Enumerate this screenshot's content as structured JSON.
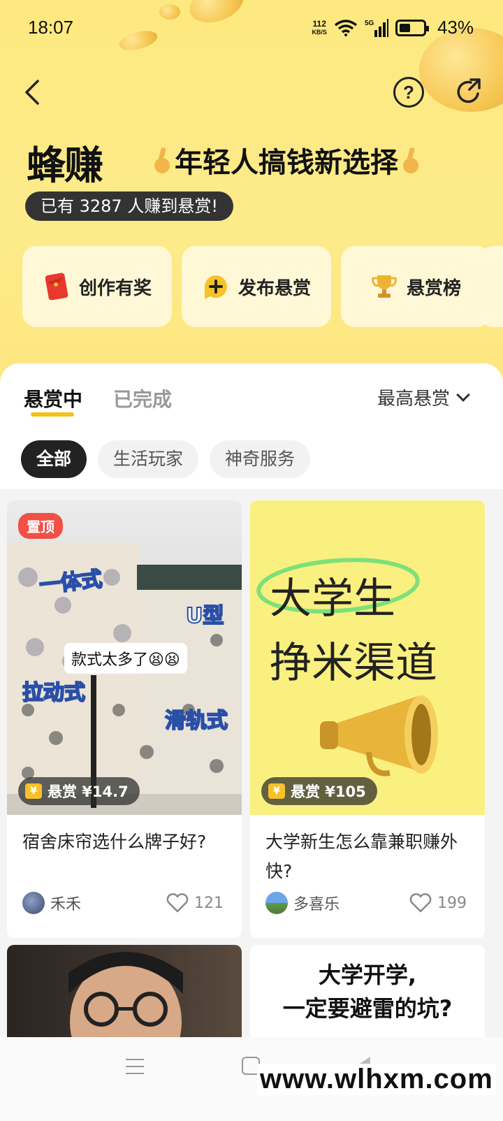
{
  "status_bar": {
    "time": "18:07",
    "speed_top": "112",
    "speed_bottom": "KB/S",
    "network": "5G",
    "battery": "43%"
  },
  "header": {
    "brand": "蜂赚",
    "slogan": "年轻人搞钱新选择",
    "counter": "已有 3287 人赚到悬赏!"
  },
  "actions": [
    {
      "label": "创作有奖",
      "icon": "red-envelope-icon"
    },
    {
      "label": "发布悬赏",
      "icon": "plus-bubble-icon"
    },
    {
      "label": "悬赏榜",
      "icon": "trophy-icon"
    }
  ],
  "tabs": {
    "active": "悬赏中",
    "inactive": "已完成",
    "sort": "最高悬赏"
  },
  "filters": [
    "全部",
    "生活玩家",
    "神奇服务"
  ],
  "cards": [
    {
      "pin": "置顶",
      "reward": "悬赏 ¥14.7",
      "title": "宿舍床帘选什么牌子好?",
      "author": "禾禾",
      "likes": "121",
      "image_labels": [
        "一体式",
        "U型",
        "款式太多了😫😫",
        "拉动式",
        "滑轨式"
      ]
    },
    {
      "reward": "悬赏 ¥105",
      "title": "大学新生怎么靠兼职赚外快?",
      "author": "多喜乐",
      "likes": "199",
      "image_labels": [
        "大学生",
        "挣米渠道"
      ]
    },
    {
      "image_labels": []
    },
    {
      "image_labels": [
        "大学开学,",
        "一定要避雷的坑?"
      ]
    }
  ],
  "watermark": "www.wlhxm.com",
  "colors": {
    "accent": "#f2c21b",
    "hero": "#fde97f",
    "pin": "#f15045"
  }
}
